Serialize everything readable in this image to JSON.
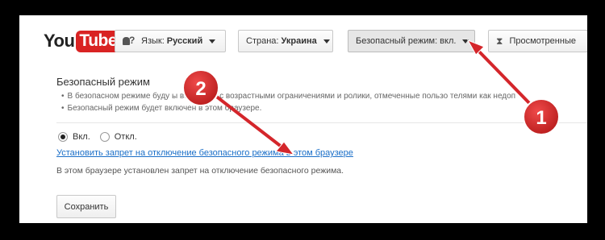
{
  "header": {
    "logo_you": "You",
    "logo_tube": "Tube",
    "language": {
      "prefix": "Язык:",
      "value": "Русский"
    },
    "country": {
      "prefix": "Страна:",
      "value": "Украина"
    },
    "safety_mode": {
      "label": "Безопасный режим: вкл."
    },
    "history": {
      "label": "Просмотренные"
    }
  },
  "safety": {
    "title": "Безопасный режим",
    "bullets": [
      "В безопасном режиме буду        ы все видео с возрастными ограничениями и ролики, отмеченные пользо     телями как недоп",
      "Безопасный режим будет включен          в этом браузере."
    ],
    "radio_on": "Вкл.",
    "radio_off": "Откл.",
    "lock_link": "Установить запрет на отключение безопасного режима в этом браузере",
    "lock_info": "В этом браузере установлен запрет на отключение безопасного режима.",
    "save_label": "Сохранить"
  },
  "annotations": {
    "badge1": "1",
    "badge2": "2",
    "accent_color": "#d4262b"
  }
}
